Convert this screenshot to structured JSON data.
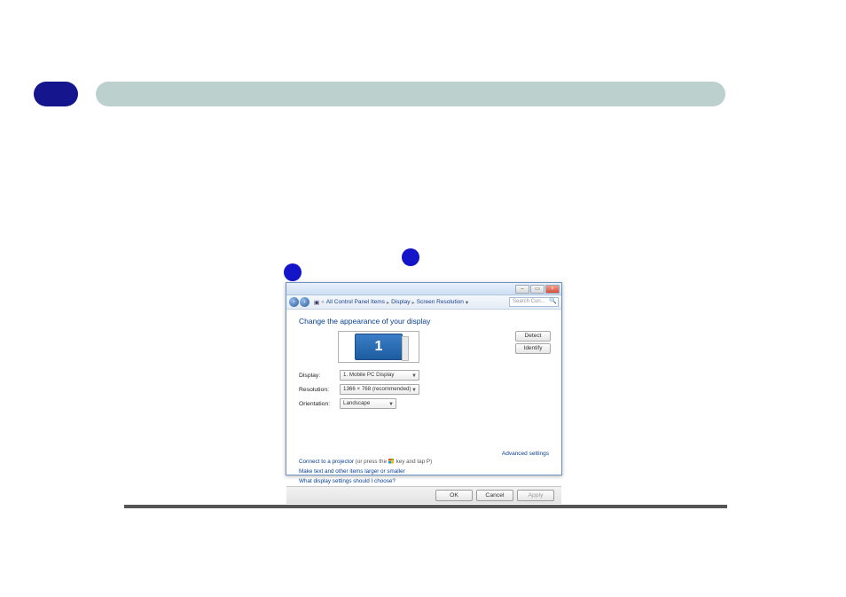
{
  "breadcrumb": {
    "items": [
      "All Control Panel Items",
      "Display",
      "Screen Resolution"
    ]
  },
  "search": {
    "placeholder": "Search Con..."
  },
  "heading": "Change the appearance of your display",
  "monitor_number": "1",
  "side_buttons": {
    "detect": "Detect",
    "identify": "Identify"
  },
  "form": {
    "display": {
      "label": "Display:",
      "value": "1. Mobile PC Display"
    },
    "resolution": {
      "label": "Resolution:",
      "value": "1366 × 768 (recommended)"
    },
    "orientation": {
      "label": "Orientation:",
      "value": "Landscape"
    }
  },
  "advanced_link": "Advanced settings",
  "links": {
    "projector_link": "Connect to a projector",
    "projector_hint_before": " (or press the ",
    "projector_hint_after": " key and tap P)",
    "make_text": "Make text and other items larger or smaller",
    "what_settings": "What display settings should I choose?"
  },
  "buttons": {
    "ok": "OK",
    "cancel": "Cancel",
    "apply": "Apply"
  }
}
